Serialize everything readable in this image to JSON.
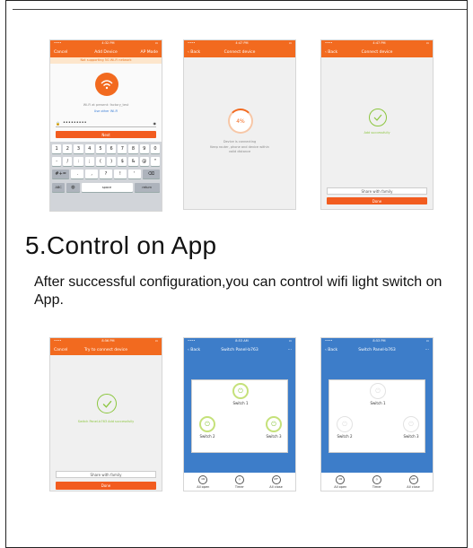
{
  "section": {
    "heading": "5.Control on App",
    "paragraph": "After successful configuration,you can control wifi light switch on App."
  },
  "phone1": {
    "status_time": "4:32 PM",
    "nav_left": "Cancel",
    "nav_title": "Add Device",
    "nav_right": "AP Mode",
    "warning": "Not supporting 5G Wi-Fi network",
    "wifi_text": "Wi-Fi at present: factory_test",
    "use_other": "Use other Wi-Fi",
    "password": "•••••••••",
    "next_label": "Next",
    "kb_row1": [
      "1",
      "2",
      "3",
      "4",
      "5",
      "6",
      "7",
      "8",
      "9",
      "0"
    ],
    "kb_row2": [
      "-",
      "/",
      ":",
      ";",
      "(",
      ")",
      "$",
      "&",
      "@",
      "\""
    ],
    "kb_row3": [
      ".",
      ",",
      "?",
      "!",
      "'"
    ],
    "kb_abc": "ABC",
    "kb_space": "space",
    "kb_return": "return"
  },
  "phone2": {
    "status_time": "4:47 PM",
    "nav_left": "Back",
    "nav_title": "Connect device",
    "progress": "4%",
    "line1": "Device is connecting",
    "line2": "Keep router, phone and device within",
    "line3": "valid distance"
  },
  "phone3": {
    "status_time": "4:47 PM",
    "nav_left": "Back",
    "nav_title": "Connect device",
    "success": "Add successfully",
    "share_label": "Share with family",
    "done_label": "Done"
  },
  "phone4": {
    "status_time": "8:56 PM",
    "nav_left": "Cancel",
    "nav_title": "Try to connect device",
    "success": "Switch Panel-b763 Add successfully",
    "share_label": "Share with family",
    "done_label": "Done"
  },
  "phone5": {
    "status_time": "8:53 AM",
    "nav_left": "Back",
    "nav_title": "Switch Panel-b763",
    "switch1": "Switch 1",
    "switch2": "Switch 2",
    "switch3": "Switch 3",
    "bb_on": "All open",
    "bb_timer": "Timer",
    "bb_off": "All close",
    "icon_on": "ON",
    "icon_off": "OFF"
  },
  "phone6": {
    "status_time": "8:53 PM",
    "nav_left": "Back",
    "nav_title": "Switch Panel-b763",
    "switch1": "Switch 1",
    "switch2": "Switch 2",
    "switch3": "Switch 3",
    "bb_on": "All open",
    "bb_timer": "Timer",
    "bb_off": "All close",
    "icon_on": "ON",
    "icon_off": "OFF"
  }
}
